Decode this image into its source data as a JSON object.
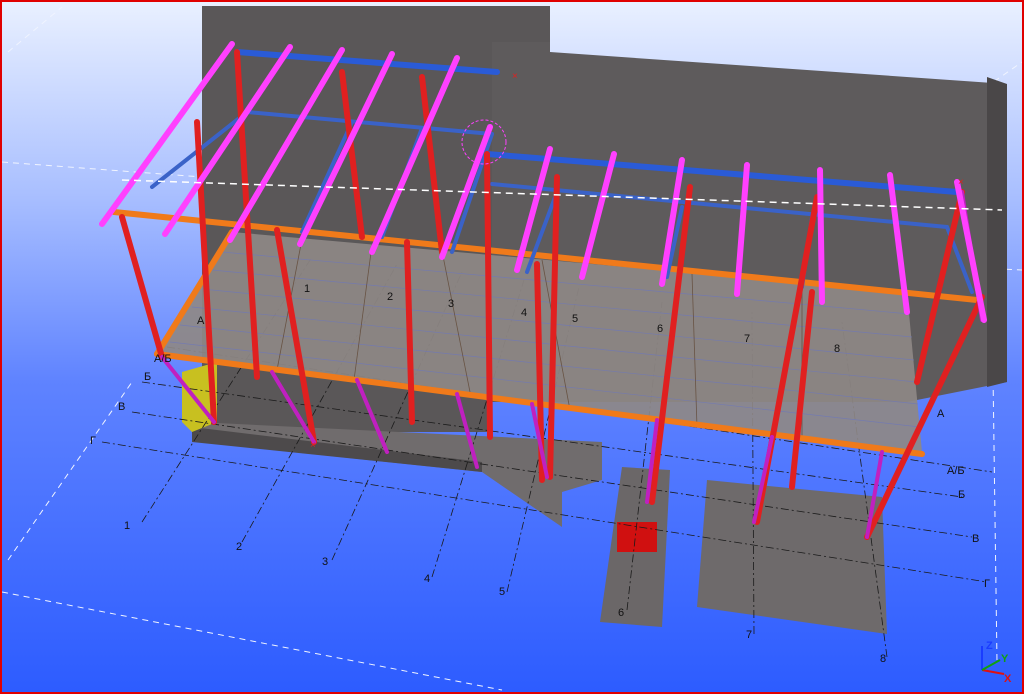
{
  "model_view": {
    "grid_letters": [
      "А",
      "А/Б",
      "Б",
      "В",
      "Г"
    ],
    "grid_numbers": [
      "1",
      "2",
      "3",
      "4",
      "5",
      "6",
      "7",
      "8"
    ],
    "axis_triad": {
      "z": "Z",
      "y": "Y",
      "x": "X"
    }
  },
  "colors": {
    "background_top": "#e9f0ff",
    "background_bottom": "#2d5cff",
    "column": "#e02020",
    "brace": "#c020c0",
    "rafter": "#ff40ff",
    "beam_blue": "#2a5bd7",
    "beam_orange": "#f07a1a",
    "concrete_wall": "#5a5758",
    "slab": "#8e8886",
    "frame_border": "#e00000"
  }
}
